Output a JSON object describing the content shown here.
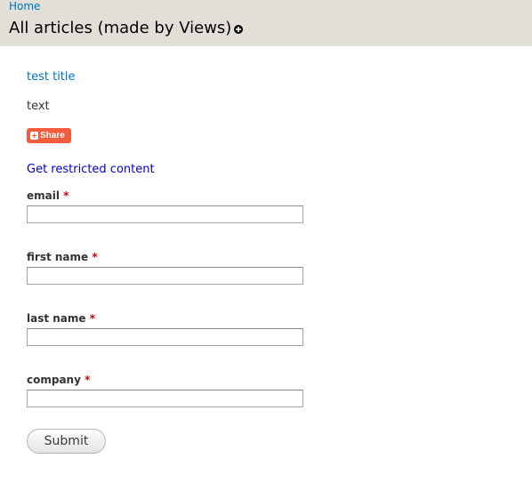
{
  "breadcrumb": {
    "home_label": "Home"
  },
  "page": {
    "title": "All articles (made by Views)"
  },
  "node": {
    "title": "test title",
    "body": "text",
    "share_label": "Share"
  },
  "restricted_link": "Get restricted content",
  "form": {
    "required_marker": "*",
    "fields": [
      {
        "label": "email",
        "value": ""
      },
      {
        "label": "first name",
        "value": ""
      },
      {
        "label": "last name",
        "value": ""
      },
      {
        "label": "company",
        "value": ""
      }
    ],
    "submit_label": "Submit"
  },
  "colors": {
    "header_bg": "#e1dfd8",
    "link": "#0074bd",
    "share_bg": "#f35b3d",
    "required": "#cc0000"
  },
  "icons": {
    "shortcut": "add-shortcut-icon",
    "share": "plus-icon"
  }
}
